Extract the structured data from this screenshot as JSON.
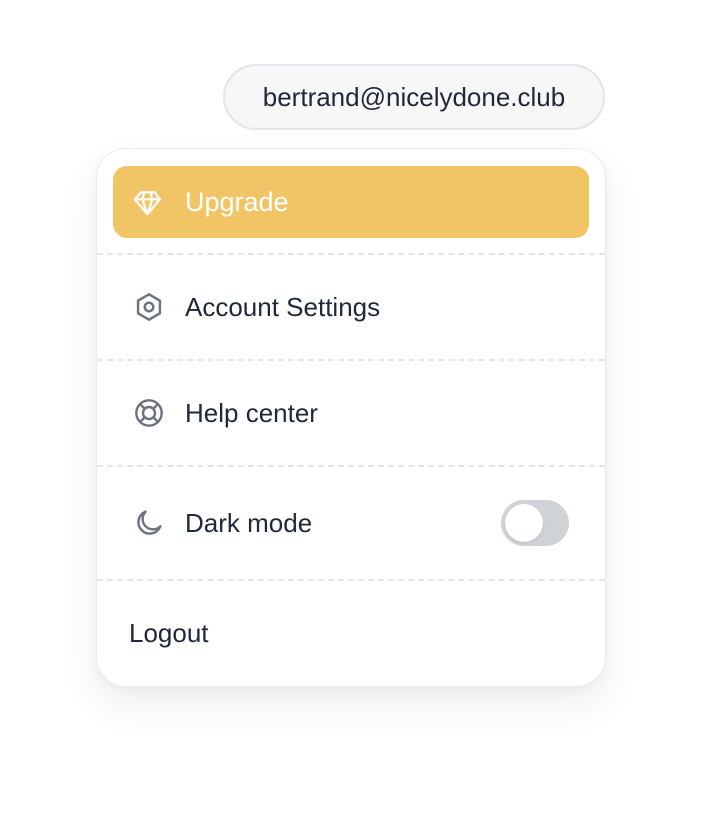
{
  "account": {
    "email": "bertrand@nicelydone.club"
  },
  "menu": {
    "upgrade": {
      "label": "Upgrade",
      "icon": "diamond-icon",
      "color": "#F1C466"
    },
    "items": [
      {
        "label": "Account Settings",
        "icon": "settings-hexagon-icon"
      },
      {
        "label": "Help center",
        "icon": "lifebuoy-icon"
      },
      {
        "label": "Dark mode",
        "icon": "moon-icon",
        "toggle": {
          "on": false
        }
      }
    ],
    "logout": {
      "label": "Logout"
    }
  }
}
